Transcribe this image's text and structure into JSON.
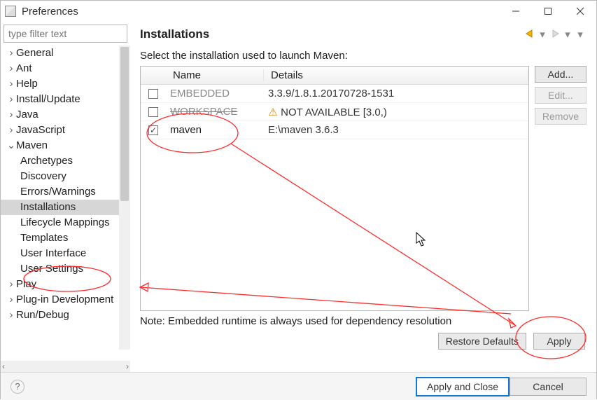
{
  "window": {
    "title": "Preferences"
  },
  "filter": {
    "placeholder": "type filter text"
  },
  "tree": {
    "general": "General",
    "ant": "Ant",
    "help": "Help",
    "install_update": "Install/Update",
    "java": "Java",
    "javascript": "JavaScript",
    "maven": "Maven",
    "maven_children": {
      "archetypes": "Archetypes",
      "discovery": "Discovery",
      "errors_warnings": "Errors/Warnings",
      "installations": "Installations",
      "lifecycle_mappings": "Lifecycle Mappings",
      "templates": "Templates",
      "user_interface": "User Interface",
      "user_settings": "User Settings"
    },
    "play": "Play",
    "plugin_dev": "Plug-in Development",
    "run_debug": "Run/Debug"
  },
  "page": {
    "title": "Installations",
    "instruction": "Select the installation used to launch Maven:",
    "columns": {
      "name": "Name",
      "details": "Details"
    },
    "rows": {
      "embedded": {
        "name": "EMBEDDED",
        "details": "3.3.9/1.8.1.20170728-1531"
      },
      "workspace": {
        "name": "WORKSPACE",
        "details": "NOT AVAILABLE [3.0,)"
      },
      "maven": {
        "name": "maven",
        "details": "E:\\maven 3.6.3"
      }
    },
    "buttons": {
      "add": "Add...",
      "edit": "Edit...",
      "remove": "Remove"
    },
    "note": "Note: Embedded runtime is always used for dependency resolution",
    "restore_defaults": "Restore Defaults",
    "apply": "Apply"
  },
  "bottom": {
    "apply_close": "Apply and Close",
    "cancel": "Cancel"
  }
}
